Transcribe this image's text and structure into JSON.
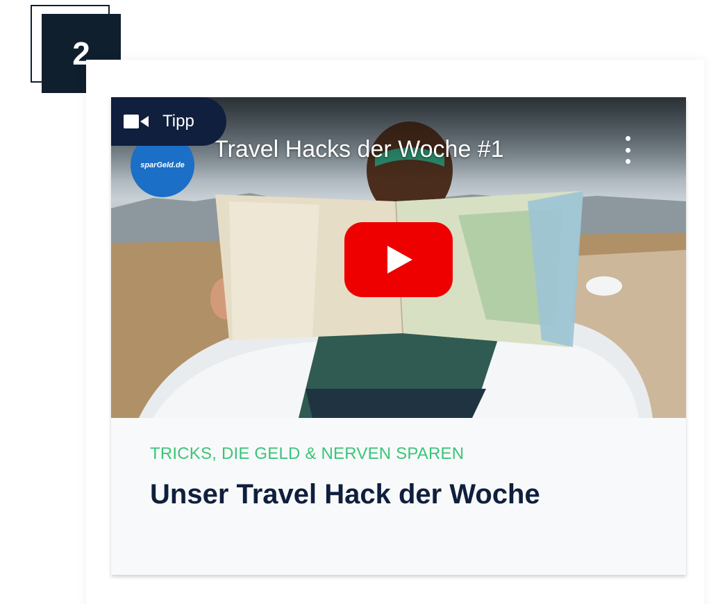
{
  "step": {
    "number": "2"
  },
  "card": {
    "tag": {
      "label": "Tipp",
      "icon": "video-camera-icon"
    },
    "video": {
      "channel": "sparGeld.de",
      "title": "Travel Hacks der Woche #1",
      "menu_icon": "more-vertical-icon",
      "play_icon": "youtube-play-icon"
    },
    "kicker": "TRICKS, DIE GELD & NERVEN SPAREN",
    "headline": "Unser Travel Hack der Woche"
  },
  "colors": {
    "navy": "#0f1f3d",
    "badge": "#0f1f2e",
    "accent_green": "#3cc47a",
    "youtube_red": "#ee0000"
  }
}
